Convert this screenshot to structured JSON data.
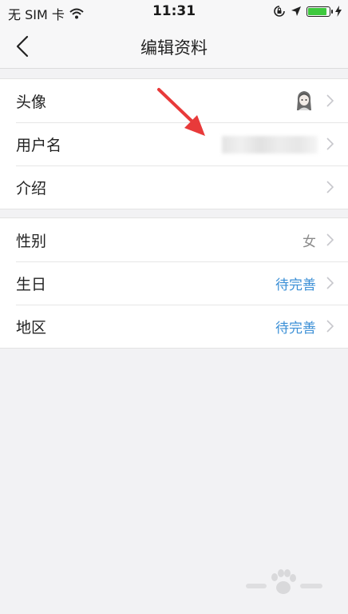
{
  "status_bar": {
    "carrier": "无 SIM 卡",
    "time": "11:31",
    "battery_level": 0.9,
    "icons": [
      "wifi-icon",
      "rotation-lock-icon",
      "location-arrow-icon",
      "battery-icon",
      "charging-bolt-icon"
    ]
  },
  "nav": {
    "title": "编辑资料",
    "back_icon": "chevron-left-icon"
  },
  "profile_group": {
    "rows": [
      {
        "label": "头像",
        "value": ""
      },
      {
        "label": "用户名",
        "value": ""
      },
      {
        "label": "介绍",
        "value": ""
      }
    ]
  },
  "info_group": {
    "rows": [
      {
        "label": "性别",
        "value": "女"
      },
      {
        "label": "生日",
        "value": "待完善"
      },
      {
        "label": "地区",
        "value": "待完善"
      }
    ]
  },
  "colors": {
    "background": "#f2f2f4",
    "link": "#3b8fd6",
    "muted": "#8a8a8a",
    "annotation_arrow": "#e83a3a"
  }
}
